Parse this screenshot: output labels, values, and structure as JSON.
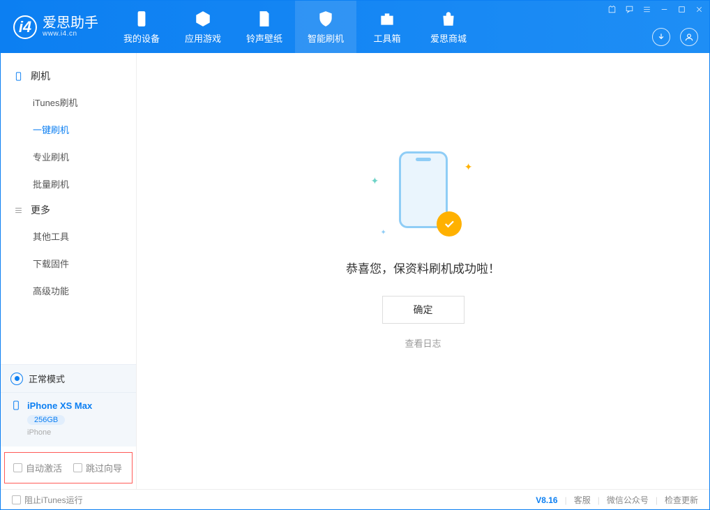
{
  "brand": {
    "name": "爱思助手",
    "subtitle": "www.i4.cn"
  },
  "nav": {
    "tabs": [
      {
        "label": "我的设备"
      },
      {
        "label": "应用游戏"
      },
      {
        "label": "铃声壁纸"
      },
      {
        "label": "智能刷机"
      },
      {
        "label": "工具箱"
      },
      {
        "label": "爱思商城"
      }
    ]
  },
  "sidebar": {
    "sections": [
      {
        "title": "刷机",
        "items": [
          {
            "label": "iTunes刷机"
          },
          {
            "label": "一键刷机"
          },
          {
            "label": "专业刷机"
          },
          {
            "label": "批量刷机"
          }
        ]
      },
      {
        "title": "更多",
        "items": [
          {
            "label": "其他工具"
          },
          {
            "label": "下载固件"
          },
          {
            "label": "高级功能"
          }
        ]
      }
    ],
    "mode_label": "正常模式",
    "device": {
      "name": "iPhone XS Max",
      "capacity": "256GB",
      "type": "iPhone"
    },
    "checks": {
      "auto_activate": "自动激活",
      "skip_wizard": "跳过向导"
    }
  },
  "main": {
    "success_msg": "恭喜您，保资料刷机成功啦！",
    "ok_label": "确定",
    "log_link": "查看日志"
  },
  "footer": {
    "block_itunes": "阻止iTunes运行",
    "version": "V8.16",
    "links": [
      "客服",
      "微信公众号",
      "检查更新"
    ]
  }
}
